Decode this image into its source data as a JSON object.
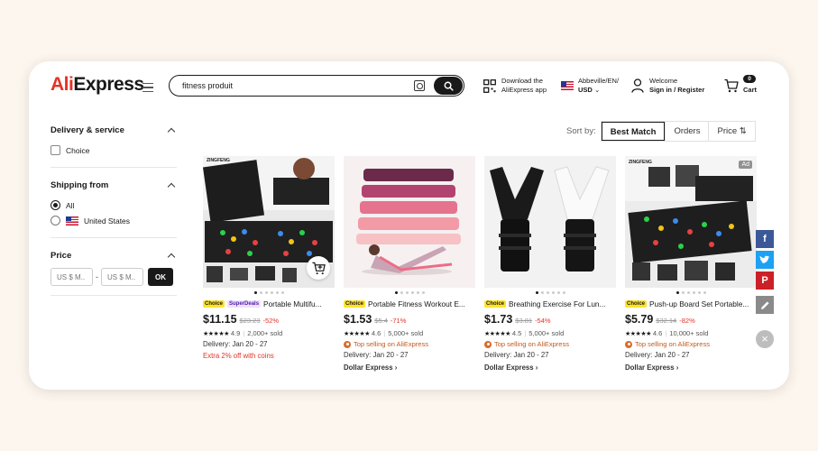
{
  "header": {
    "logo_prefix": "Ali",
    "logo_suffix": "Express",
    "search_value": "fitness produit",
    "app_line1": "Download the",
    "app_line2": "AliExpress app",
    "locale_line1": "Abbeville/EN/",
    "locale_line2": "USD",
    "welcome": "Welcome",
    "signin": "Sign in / Register",
    "cart_count": "0",
    "cart_label": "Cart"
  },
  "filters": {
    "delivery": {
      "title": "Delivery & service",
      "options": [
        "Choice"
      ]
    },
    "shipping": {
      "title": "Shipping from",
      "options": [
        "All",
        "United States"
      ],
      "selected": "All"
    },
    "price": {
      "title": "Price",
      "min_placeholder": "US $ M..",
      "max_placeholder": "US $ M..",
      "ok_label": "OK"
    }
  },
  "sort": {
    "label": "Sort by:",
    "tabs": [
      "Best Match",
      "Orders",
      "Price"
    ],
    "active": "Best Match"
  },
  "products": [
    {
      "choice": "Choice",
      "superdeals": "SuperDeals",
      "title": "Portable Multifu...",
      "price": "$11.15",
      "old_price": "$23.23",
      "discount": "-52%",
      "rating": "4.9",
      "sold": "2,000+ sold",
      "delivery": "Delivery: Jan 20 - 27",
      "extra": "Extra 2% off with coins"
    },
    {
      "choice": "Choice",
      "title": "Portable Fitness Workout E...",
      "price": "$1.53",
      "old_price": "$5.4",
      "discount": "-71%",
      "rating": "4.6",
      "sold": "5,000+ sold",
      "top_selling": "Top selling on AliExpress",
      "delivery": "Delivery: Jan 20 - 27",
      "express": "Dollar Express"
    },
    {
      "choice": "Choice",
      "title": "Breathing Exercise For Lun...",
      "price": "$1.73",
      "old_price": "$3.81",
      "discount": "-54%",
      "rating": "4.5",
      "sold": "5,000+ sold",
      "top_selling": "Top selling on AliExpress",
      "delivery": "Delivery: Jan 20 - 27",
      "express": "Dollar Express"
    },
    {
      "choice": "Choice",
      "title": "Push-up Board Set Portable...",
      "price": "$5.79",
      "old_price": "$32.14",
      "discount": "-82%",
      "rating": "4.6",
      "sold": "10,000+ sold",
      "top_selling": "Top selling on AliExpress",
      "delivery": "Delivery: Jan 20 - 27",
      "express": "Dollar Express",
      "ad": "Ad"
    }
  ],
  "colors": {
    "brand_red": "#e43225",
    "choice_yellow": "#fde32b",
    "facebook": "#3b5998",
    "twitter": "#1da1f2",
    "pinterest": "#cb2027"
  }
}
